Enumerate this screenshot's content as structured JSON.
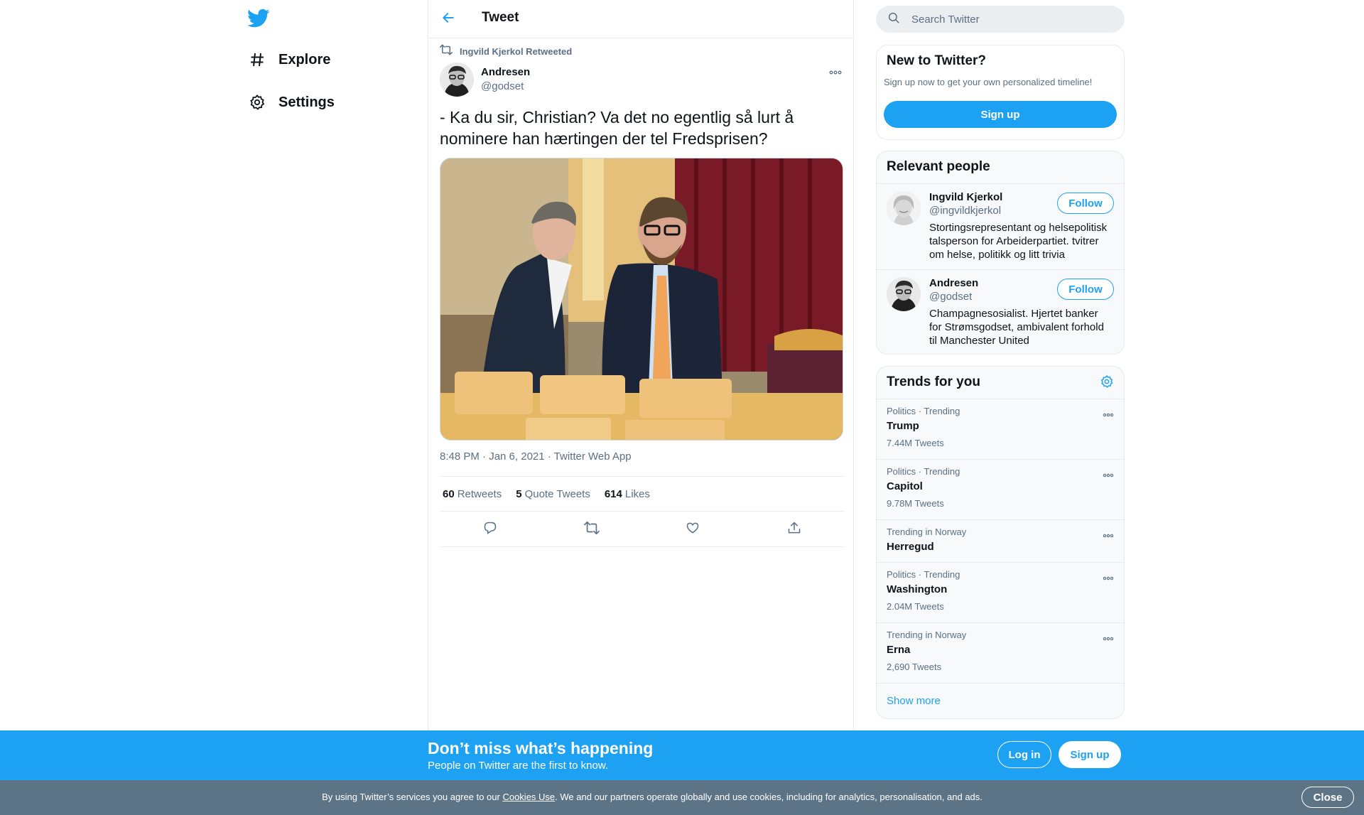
{
  "nav": {
    "logo": "twitter-bird-icon",
    "items": [
      {
        "label": "Explore",
        "icon": "hashtag-icon"
      },
      {
        "label": "Settings",
        "icon": "gear-icon"
      }
    ]
  },
  "header": {
    "title": "Tweet",
    "back_icon": "arrow-left-icon"
  },
  "tweet": {
    "retweeted_by": "Ingvild Kjerkol Retweeted",
    "author_name": "Andresen",
    "author_handle": "@godset",
    "text": "- Ka du sir, Christian? Va det no egentlig så lurt å nominere han hærtingen der tel Fredsprisen?",
    "timestamp": "8:48 PM · Jan 6, 2021 · Twitter Web App",
    "stats": {
      "retweets_count": "60",
      "retweets_label": "Retweets",
      "quotes_count": "5",
      "quotes_label": "Quote Tweets",
      "likes_count": "614",
      "likes_label": "Likes"
    },
    "actions": [
      "reply-icon",
      "retweet-icon",
      "like-icon",
      "share-icon"
    ]
  },
  "search": {
    "placeholder": "Search Twitter"
  },
  "new_to_twitter": {
    "title": "New to Twitter?",
    "subtitle": "Sign up now to get your own personalized timeline!",
    "button": "Sign up"
  },
  "relevant_people": {
    "title": "Relevant people",
    "people": [
      {
        "name": "Ingvild Kjerkol",
        "handle": "@ingvildkjerkol",
        "bio": "Stortingsrepresentant og helsepolitisk talsperson for Arbeiderpartiet. tvitrer om helse, politikk og litt trivia",
        "button": "Follow"
      },
      {
        "name": "Andresen",
        "handle": "@godset",
        "bio": "Champagnesosialist. Hjertet banker for Strømsgodset, ambivalent forhold til Manchester United",
        "button": "Follow"
      }
    ]
  },
  "trends": {
    "title": "Trends for you",
    "items": [
      {
        "context": "Politics · Trending",
        "name": "Trump",
        "count": "7.44M Tweets"
      },
      {
        "context": "Politics · Trending",
        "name": "Capitol",
        "count": "9.78M Tweets"
      },
      {
        "context": "Trending in Norway",
        "name": "Herregud",
        "count": ""
      },
      {
        "context": "Politics · Trending",
        "name": "Washington",
        "count": "2.04M Tweets"
      },
      {
        "context": "Trending in Norway",
        "name": "Erna",
        "count": "2,690 Tweets"
      }
    ],
    "show_more": "Show more"
  },
  "banner": {
    "title": "Don’t miss what’s happening",
    "subtitle": "People on Twitter are the first to know.",
    "login": "Log in",
    "signup": "Sign up"
  },
  "cookie": {
    "text_before": "By using Twitter’s services you agree to our ",
    "link": "Cookies Use",
    "text_after": ". We and our partners operate globally and use cookies, including for analytics, personalisation, and ads.",
    "close": "Close"
  },
  "colors": {
    "accent": "#1da1f2",
    "text_primary": "#0f1419",
    "text_secondary": "#5b7083",
    "cookie_bar": "#5d7487"
  }
}
